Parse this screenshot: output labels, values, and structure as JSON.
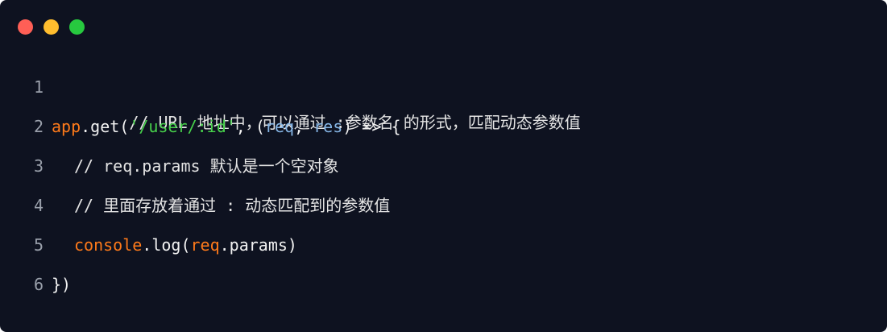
{
  "window": {
    "traffic_lights": [
      {
        "name": "close",
        "color": "#ff5f56"
      },
      {
        "name": "minimize",
        "color": "#ffbd2e"
      },
      {
        "name": "maximize",
        "color": "#27c93f"
      }
    ]
  },
  "code": {
    "lines": [
      {
        "number": "1",
        "tokens": [
          "// URL 地址中，可以通过 :参数名 的形式，匹配动态参数值"
        ]
      },
      {
        "number": "2",
        "tokens": [
          "app",
          ".",
          "get",
          "(",
          "'/user/:id'",
          ", (",
          "req",
          ", ",
          "res",
          ") => {"
        ]
      },
      {
        "number": "3",
        "tokens": [
          "// req.params 默认是一个空对象"
        ]
      },
      {
        "number": "4",
        "tokens": [
          "// 里面存放着通过 : 动态匹配到的参数值"
        ]
      },
      {
        "number": "5",
        "tokens": [
          "console",
          ".log(",
          "req",
          ".params)"
        ]
      },
      {
        "number": "6",
        "tokens": [
          "})"
        ]
      }
    ]
  }
}
